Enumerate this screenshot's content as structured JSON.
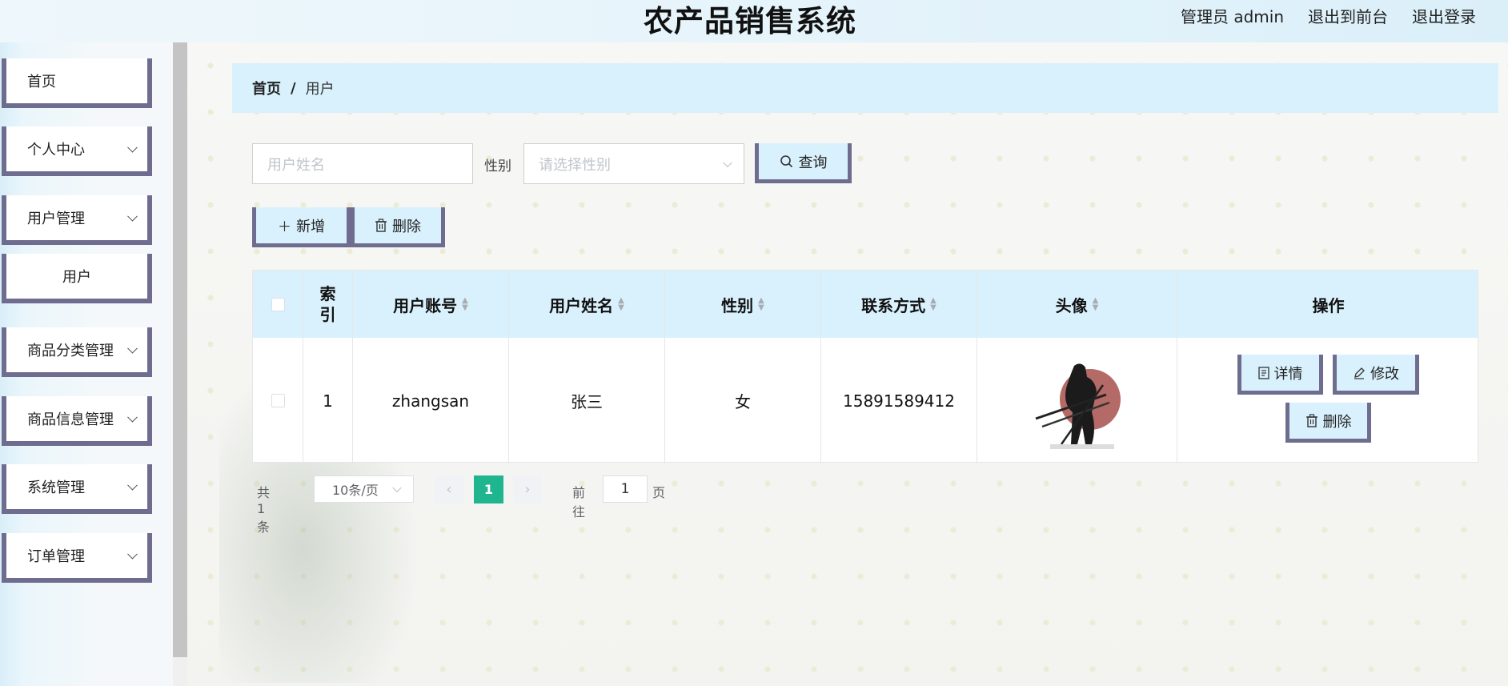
{
  "header": {
    "title": "农产品销售系统",
    "admin_label": "管理员 admin",
    "to_front": "退出到前台",
    "logout": "退出登录"
  },
  "sidebar": {
    "items": [
      {
        "label": "首页",
        "has_chevron": false
      },
      {
        "label": "个人中心",
        "has_chevron": true
      },
      {
        "label": "用户管理",
        "has_chevron": true
      },
      {
        "label": "用户",
        "has_chevron": false
      },
      {
        "label": "商品分类管理",
        "has_chevron": true
      },
      {
        "label": "商品信息管理",
        "has_chevron": true
      },
      {
        "label": "系统管理",
        "has_chevron": true
      },
      {
        "label": "订单管理",
        "has_chevron": true
      }
    ]
  },
  "breadcrumb": {
    "home": "首页",
    "separator": "/",
    "current": "用户"
  },
  "search": {
    "name_placeholder": "用户姓名",
    "gender_label": "性别",
    "gender_placeholder": "请选择性别",
    "query_button": "查询"
  },
  "actions": {
    "add": "新增",
    "delete": "删除"
  },
  "table": {
    "columns": [
      "索引",
      "用户账号",
      "用户姓名",
      "性别",
      "联系方式",
      "头像",
      "操作"
    ],
    "rows": [
      {
        "index": "1",
        "account": "zhangsan",
        "name": "张三",
        "gender": "女",
        "phone": "15891589412",
        "avatar": "samurai-avatar-image",
        "ops": {
          "detail": "详情",
          "edit": "修改",
          "delete": "删除"
        }
      }
    ]
  },
  "pagination": {
    "total": "共 1 条",
    "page_size": "10条/页",
    "current_page": "1",
    "goto_prefix": "前往",
    "goto_value": "1",
    "goto_suffix": "页"
  },
  "colors": {
    "accent_border": "#6f6d8f",
    "light_blue": "#d9f1fd",
    "page_active": "#1fb58f"
  }
}
